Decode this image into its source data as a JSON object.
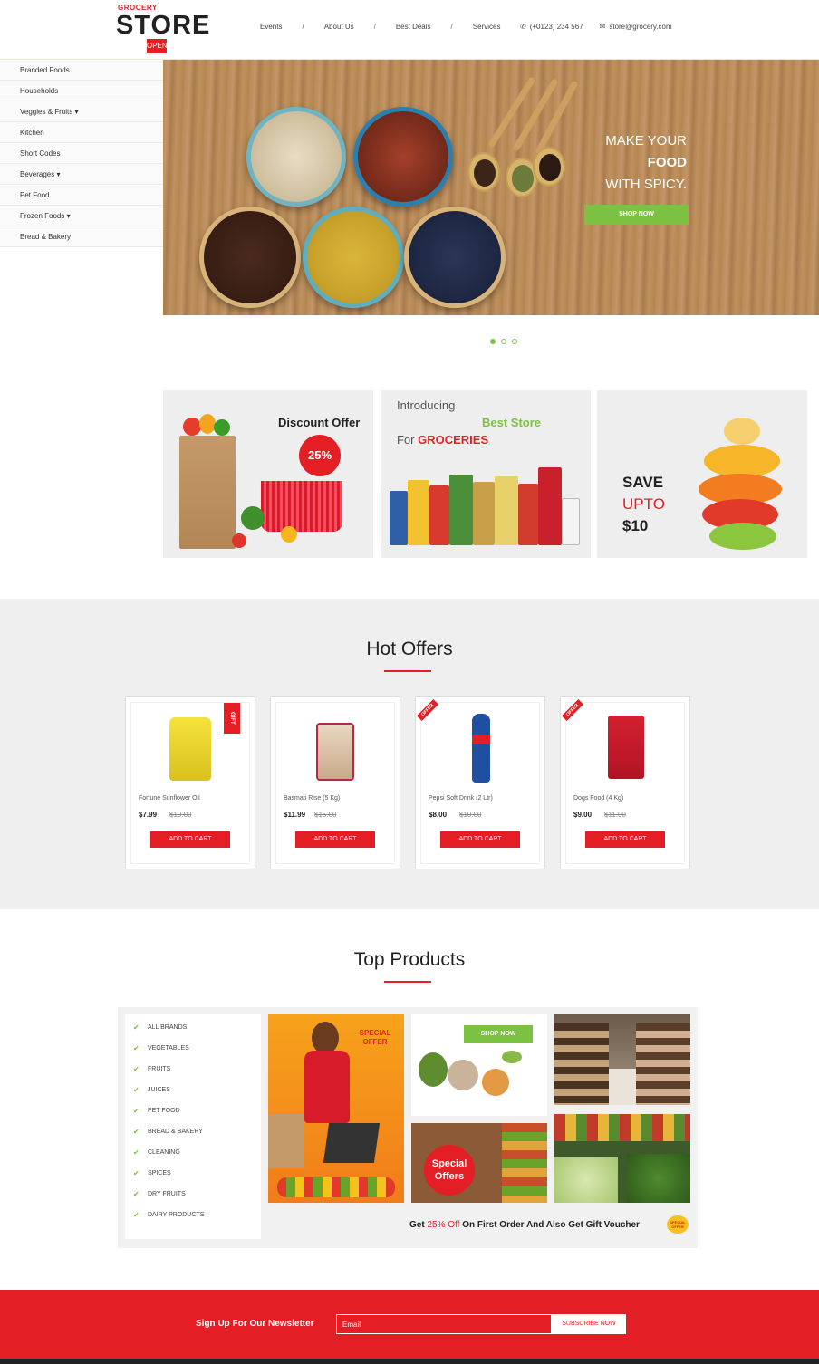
{
  "header": {
    "logo_top": "GROCERY",
    "logo_main": "STORE",
    "logo_open": "OPEN",
    "nav": [
      "Events",
      "About Us",
      "Best Deals",
      "Services"
    ],
    "nav_separator": "/",
    "phone": "(+0123) 234 567",
    "email": "store@grocery.com"
  },
  "sidebar": {
    "items": [
      {
        "label": "Branded Foods"
      },
      {
        "label": "Households"
      },
      {
        "label": "Veggies & Fruits ▾"
      },
      {
        "label": "Kitchen"
      },
      {
        "label": "Short Codes"
      },
      {
        "label": "Beverages ▾"
      },
      {
        "label": "Pet Food"
      },
      {
        "label": "Frozen Foods ▾"
      },
      {
        "label": "Bread & Bakery"
      }
    ]
  },
  "hero": {
    "line1": "MAKE YOUR",
    "line2": "FOOD",
    "line3": "WITH SPICY.",
    "button": "SHOP NOW"
  },
  "promos": {
    "discount_title": "Discount Offer",
    "discount_value": "25%",
    "intro_line1": "Introducing",
    "intro_line2": "Best Store",
    "intro_line3_prefix": "For",
    "intro_line3_highlight": "GROCERIES",
    "save_line1": "SAVE",
    "save_line2": "UPTO",
    "save_line3": "$10"
  },
  "hot_offers": {
    "title": "Hot Offers",
    "products": [
      {
        "name": "Fortune Sunflower Oil",
        "price": "$7.99",
        "old_price": "$10.00",
        "button": "ADD TO CART",
        "tag": "GIFT"
      },
      {
        "name": "Basmati Rise (5 Kg)",
        "price": "$11.99",
        "old_price": "$15.00",
        "button": "ADD TO CART",
        "tag": ""
      },
      {
        "name": "Pepsi Soft Drink (2 Ltr)",
        "price": "$8.00",
        "old_price": "$10.00",
        "button": "ADD TO CART",
        "tag": "OFFER"
      },
      {
        "name": "Dogs Food (4 Kg)",
        "price": "$9.00",
        "old_price": "$11.00",
        "button": "ADD TO CART",
        "tag": "OFFER"
      }
    ]
  },
  "top_products": {
    "title": "Top Products",
    "brands": [
      "ALL BRANDS",
      "VEGETABLES",
      "FRUITS",
      "JUICES",
      "PET FOOD",
      "BREAD & BAKERY",
      "CLEANING",
      "SPICES",
      "DRY FRUITS",
      "DAIRY PRODUCTS"
    ],
    "special_offer_badge": "SPECIAL OFFER",
    "tile_button": "SHOP NOW",
    "special_offers_badge": "Special Offers",
    "note_prefix": "Get",
    "note_highlight": "25% Off",
    "note_suffix": "On First Order And Also Get Gift Voucher",
    "special_small": "SPECIAL OFFER"
  },
  "newsletter": {
    "label": "Sign Up For Our Newsletter",
    "placeholder": "Email",
    "button": "SUBSCRIBE NOW"
  }
}
